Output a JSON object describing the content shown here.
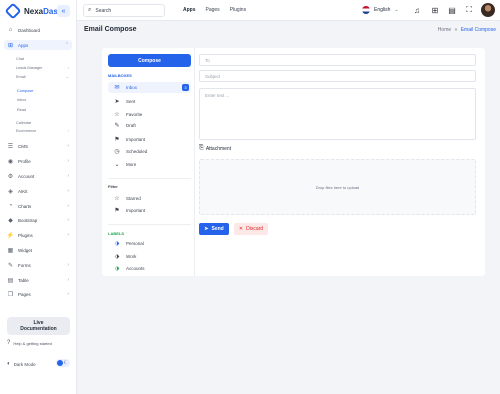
{
  "brand": {
    "name_part1": "Nexa",
    "name_part2": "Dash",
    "collapse_icon": "«"
  },
  "sidebar": {
    "items": [
      {
        "label": "Dashboard",
        "icon": "⌂"
      },
      {
        "label": "Apps",
        "icon": "⊞",
        "active": true
      },
      {
        "label": "CMS",
        "icon": "☰"
      },
      {
        "label": "Profile",
        "icon": "◉"
      },
      {
        "label": "Account",
        "icon": "⚙"
      },
      {
        "label": "AIKit",
        "icon": "◈"
      },
      {
        "label": "Charts",
        "icon": "◔"
      },
      {
        "label": "Bootstrap",
        "icon": "◆"
      },
      {
        "label": "Plugins",
        "icon": "⚡"
      },
      {
        "label": "Widget",
        "icon": "▦"
      },
      {
        "label": "Forms",
        "icon": "✎"
      },
      {
        "label": "Table",
        "icon": "▤"
      },
      {
        "label": "Pages",
        "icon": "❐"
      }
    ],
    "sub_items": [
      {
        "label": "Chat"
      },
      {
        "label": "Leads Manager"
      },
      {
        "label": "Email"
      },
      {
        "label": "Compose",
        "active": true
      },
      {
        "label": "Inbox"
      },
      {
        "label": "Read"
      },
      {
        "label": "Calendar"
      },
      {
        "label": "Ecommerce"
      }
    ],
    "live_doc_line1": "Live",
    "live_doc_line2": "Documentation",
    "help_label": "Help & getting started",
    "dark_mode_label": "Dark Mode"
  },
  "topbar": {
    "search_label": "Search",
    "nav": [
      "Apps",
      "Pages",
      "Plugins"
    ],
    "language": "English"
  },
  "page": {
    "title": "Email Compose",
    "breadcrumb_home": "Home",
    "breadcrumb_sep": "»",
    "breadcrumb_current": "Email Compose"
  },
  "mail": {
    "compose_label": "Compose",
    "mailboxes_heading": "MAILBOXES",
    "mailboxes": [
      {
        "label": "Inbox",
        "icon": "✉",
        "count": "3",
        "active": true
      },
      {
        "label": "Sent",
        "icon": "➤"
      },
      {
        "label": "Favorite",
        "icon": "☆"
      },
      {
        "label": "Draft",
        "icon": "✎"
      },
      {
        "label": "Important",
        "icon": "⚑"
      },
      {
        "label": "Scheduled",
        "icon": "◷"
      },
      {
        "label": "More",
        "icon": "⌄"
      }
    ],
    "filter_heading": "Filter",
    "filters": [
      {
        "label": "Starred",
        "icon": "☆"
      },
      {
        "label": "Important",
        "icon": "⚑"
      }
    ],
    "labels_heading": "LABELS",
    "labels": [
      {
        "label": "Personal",
        "icon": "⬗",
        "color": "#2563eb"
      },
      {
        "label": "Work",
        "icon": "⬗",
        "color": "#3d4350"
      },
      {
        "label": "Accounts",
        "icon": "⬗",
        "color": "#16a34a"
      }
    ]
  },
  "compose": {
    "to_placeholder": "To",
    "subject_placeholder": "Subject",
    "body_placeholder": "Enter text ...",
    "attachment_label": "Attachment",
    "dropzone_text": "Drop files here to upload",
    "send_label": "Send",
    "discard_label": "Discard"
  },
  "colors": {
    "accent": "#2563eb",
    "danger": "#dc2626",
    "success": "#16a34a"
  }
}
